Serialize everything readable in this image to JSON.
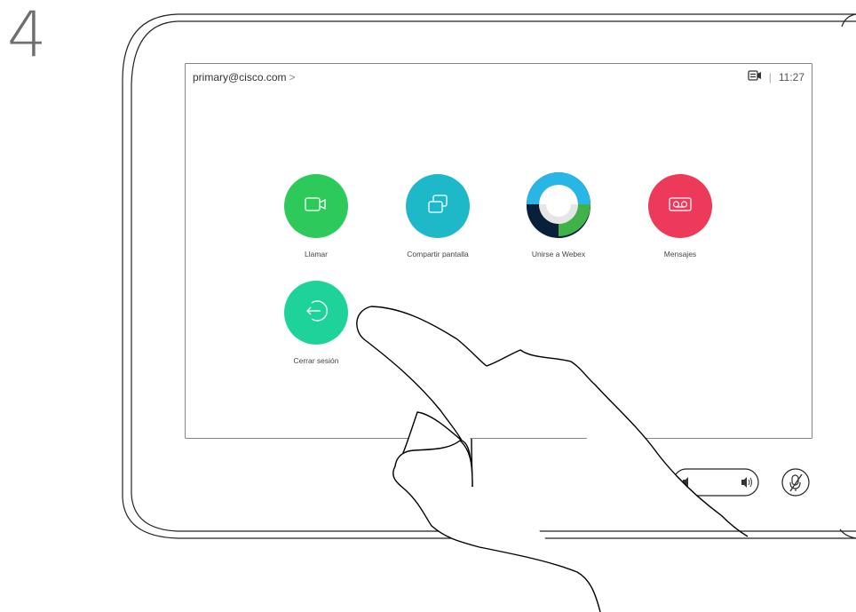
{
  "step": {
    "number": "4"
  },
  "header": {
    "account": "primary@cisco.com",
    "account_chevron": ">",
    "camera_icon": "camera-share-icon",
    "time": "11:27"
  },
  "apps": [
    {
      "label": "Llamar",
      "color": "#2dc95b",
      "icon": "video-camera-icon"
    },
    {
      "label": "Compartir pantalla",
      "color": "#1eb9c9",
      "icon": "share-screen-icon"
    },
    {
      "label": "Unirse a Webex",
      "color": "#0a1f3a",
      "icon": "webex-logo-icon"
    },
    {
      "label": "Mensajes",
      "color": "#ee3a5a",
      "icon": "voicemail-icon"
    },
    {
      "label": "Cerrar sesión",
      "color": "#1ed39a",
      "icon": "sign-out-icon"
    }
  ],
  "controls": {
    "volume_down_icon": "volume-down-icon",
    "volume_up_icon": "volume-up-icon",
    "mute_icon": "microphone-mute-icon"
  }
}
